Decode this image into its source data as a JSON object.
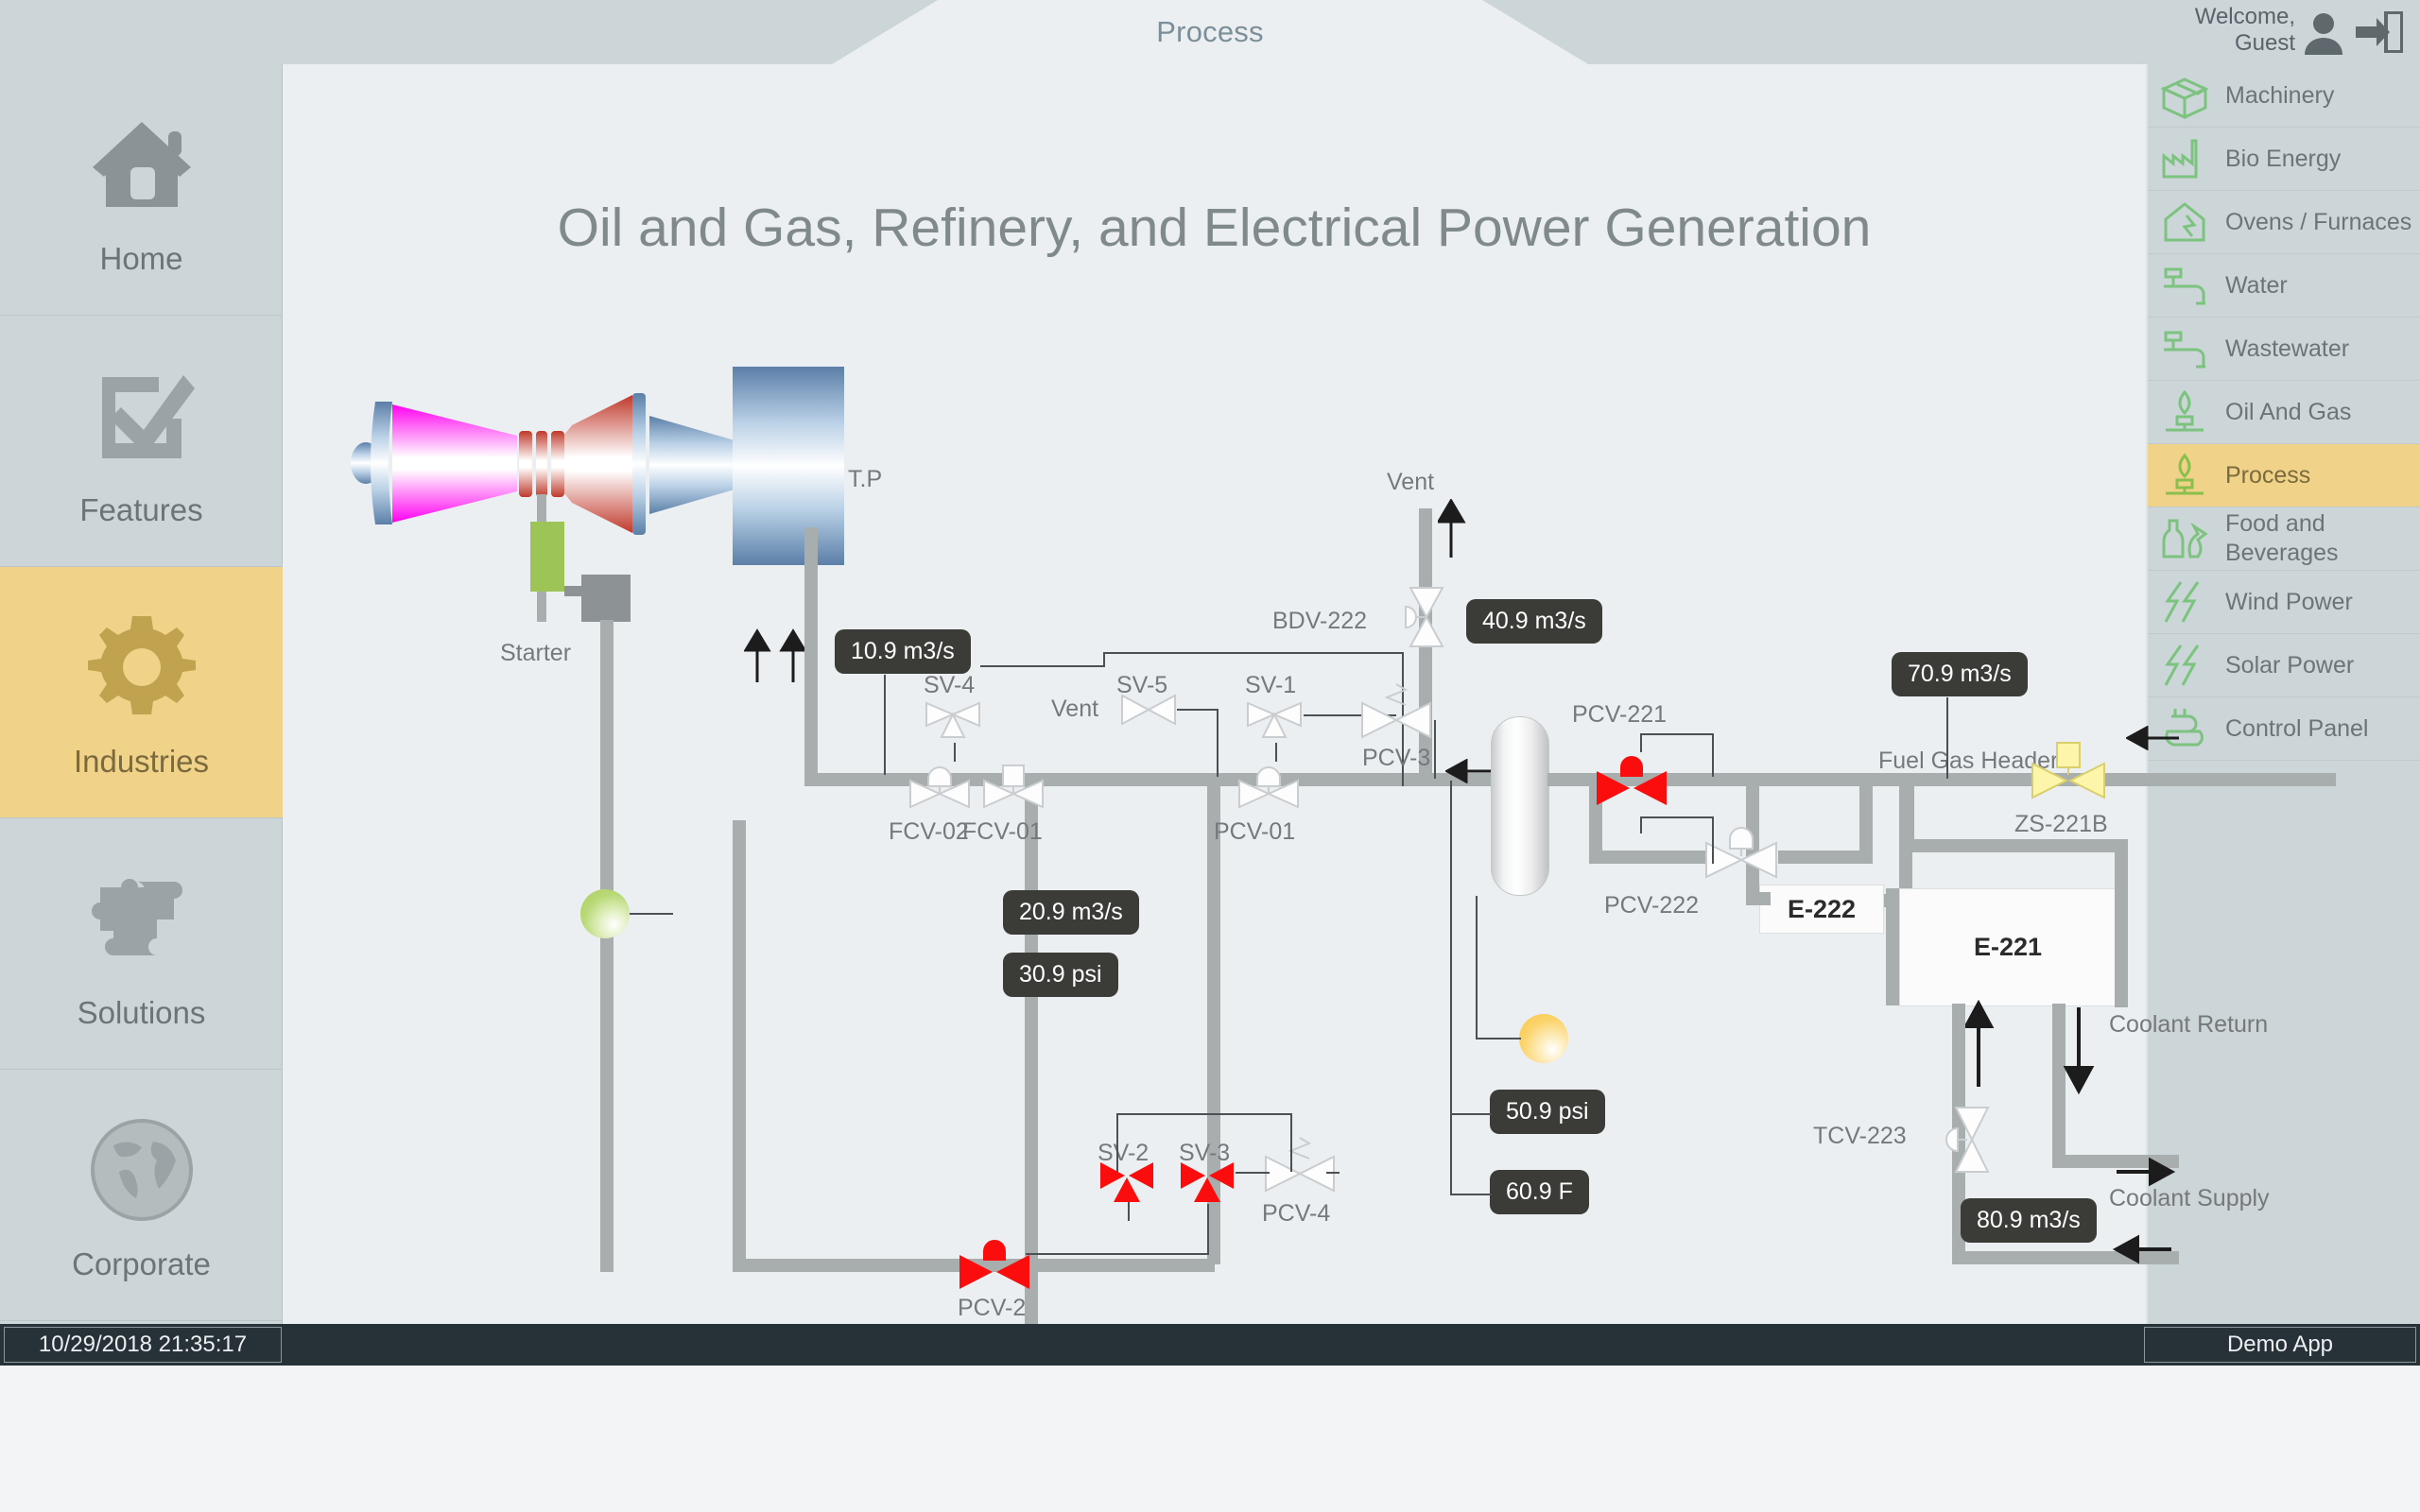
{
  "header": {
    "tab_label": "Process",
    "welcome_line1": "Welcome,",
    "welcome_line2": "Guest",
    "user_icon": "user-avatar-icon",
    "logout_icon": "logout-icon"
  },
  "page": {
    "title": "Oil and Gas, Refinery, and Electrical Power Generation"
  },
  "left_nav": {
    "items": [
      {
        "label": "Home",
        "icon": "home-icon",
        "active": false
      },
      {
        "label": "Features",
        "icon": "checkbox-icon",
        "active": false
      },
      {
        "label": "Industries",
        "icon": "gear-icon",
        "active": true
      },
      {
        "label": "Solutions",
        "icon": "puzzle-icon",
        "active": false
      },
      {
        "label": "Corporate",
        "icon": "globe-icon",
        "active": false
      }
    ]
  },
  "right_nav": {
    "items": [
      {
        "label": "Machinery",
        "icon": "box-icon",
        "active": false
      },
      {
        "label": "Bio Energy",
        "icon": "factory-icon",
        "active": false
      },
      {
        "label": "Ovens / Furnaces",
        "icon": "oven-icon",
        "active": false
      },
      {
        "label": "Water",
        "icon": "faucet-icon",
        "active": false
      },
      {
        "label": "Wastewater",
        "icon": "faucet-icon",
        "active": false
      },
      {
        "label": "Oil And Gas",
        "icon": "flare-icon",
        "active": false
      },
      {
        "label": "Process",
        "icon": "flare-icon",
        "active": true
      },
      {
        "label": "Food and Beverages",
        "icon": "bottle-icon",
        "active": false
      },
      {
        "label": "Wind Power",
        "icon": "bolt-icon",
        "active": false
      },
      {
        "label": "Solar Power",
        "icon": "bolt-icon",
        "active": false
      },
      {
        "label": "Control Panel",
        "icon": "plug-icon",
        "active": false
      }
    ]
  },
  "status_bar": {
    "timestamp": "10/29/2018 21:35:17",
    "app_name": "Demo App"
  },
  "diagram": {
    "equipment_labels": {
      "turbine": "T.P",
      "starter": "Starter",
      "exchanger_1": "E-221",
      "exchanger_2": "E-222"
    },
    "stream_labels": {
      "vent_top": "Vent",
      "vent_mid": "Vent",
      "fuel_gas_header": "Fuel Gas Header",
      "coolant_return": "Coolant Return",
      "coolant_supply": "Coolant Supply"
    },
    "valves": [
      {
        "tag": "SV-4",
        "state": "normal"
      },
      {
        "tag": "SV-5",
        "state": "normal"
      },
      {
        "tag": "SV-1",
        "state": "normal"
      },
      {
        "tag": "SV-2",
        "state": "alarm"
      },
      {
        "tag": "SV-3",
        "state": "alarm"
      },
      {
        "tag": "FCV-02",
        "state": "normal"
      },
      {
        "tag": "FCV-01",
        "state": "normal"
      },
      {
        "tag": "PCV-01",
        "state": "normal"
      },
      {
        "tag": "PCV-3",
        "state": "normal"
      },
      {
        "tag": "PCV-4",
        "state": "normal"
      },
      {
        "tag": "PCV-2",
        "state": "alarm"
      },
      {
        "tag": "BDV-222",
        "state": "normal"
      },
      {
        "tag": "PCV-221",
        "state": "alarm"
      },
      {
        "tag": "PCV-222",
        "state": "normal"
      },
      {
        "tag": "ZS-221B",
        "state": "warn"
      },
      {
        "tag": "TCV-223",
        "state": "normal"
      }
    ],
    "readouts": [
      {
        "id": "compressor_flow",
        "value": "10.9 m3/s"
      },
      {
        "id": "feed_flow",
        "value": "20.9 m3/s"
      },
      {
        "id": "feed_pressure",
        "value": "30.9 psi"
      },
      {
        "id": "vent_flow",
        "value": "40.9 m3/s"
      },
      {
        "id": "separator_pressure",
        "value": "50.9 psi"
      },
      {
        "id": "separator_temp",
        "value": "60.9 F"
      },
      {
        "id": "fuel_gas_flow",
        "value": "70.9 m3/s"
      },
      {
        "id": "coolant_flow",
        "value": "80.9 m3/s"
      }
    ],
    "indicators": [
      {
        "id": "status-lamp-green",
        "color": "#b9d977"
      },
      {
        "id": "status-lamp-amber",
        "color": "#fbd36a"
      }
    ],
    "colors": {
      "accent": "#f0d289",
      "pipe": "#a8adae",
      "alarm": "#fb0d0d",
      "warn": "#fbf5a2",
      "panel": "#ccd5d7",
      "canvas": "#eceff1",
      "status_bar": "#263238"
    }
  }
}
